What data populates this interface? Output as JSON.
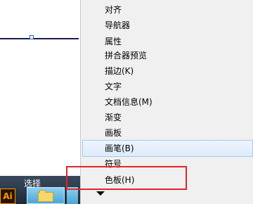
{
  "taskbar": {
    "label": "选择",
    "app_icon_text": "Ai"
  },
  "menu": {
    "items": [
      {
        "label": "对齐"
      },
      {
        "label": "导航器"
      },
      {
        "label": "属性"
      },
      {
        "label": "拼合器预览"
      },
      {
        "label": "描边(K)"
      },
      {
        "label": "文字"
      },
      {
        "label": "文档信息(M)"
      },
      {
        "label": "渐变"
      },
      {
        "label": "画板"
      },
      {
        "label": "画笔(B)"
      },
      {
        "label": "符号"
      },
      {
        "label": "色板(H)"
      }
    ]
  },
  "colors": {
    "highlight_box": "#e0262b",
    "hover_item": "#dcebfb",
    "ai_orange": "#ff9a00"
  }
}
